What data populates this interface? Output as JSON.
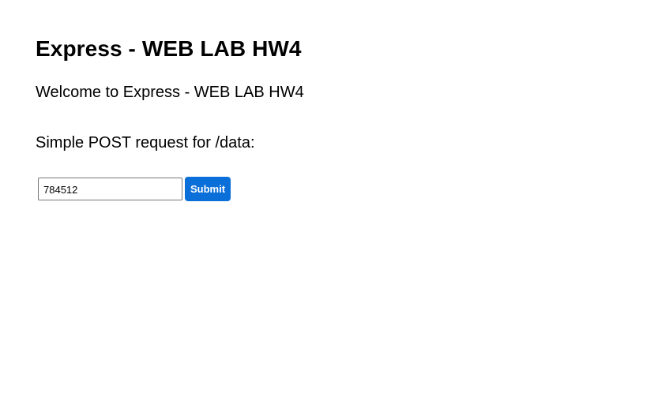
{
  "page": {
    "title": "Express - WEB LAB HW4",
    "welcome_text": "Welcome to Express - WEB LAB HW4",
    "post_label": "Simple POST request for /data:"
  },
  "form": {
    "input_value": "784512",
    "submit_label": "Submit"
  },
  "colors": {
    "submit_background": "#0b6fd9",
    "submit_text": "#ffffff"
  }
}
